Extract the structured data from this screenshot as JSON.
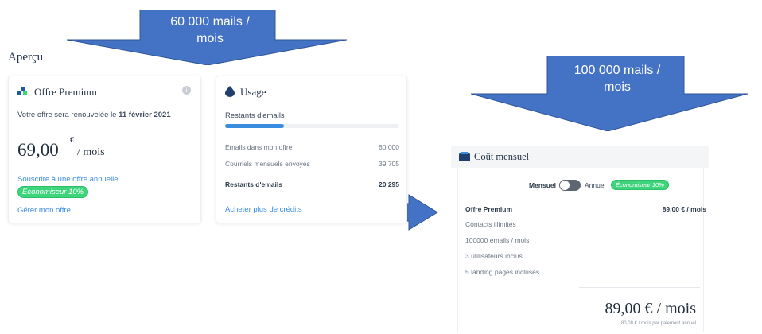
{
  "callouts": {
    "left": "60 000 mails /\nmois",
    "right": "100 000 mails /\nmois"
  },
  "section_title": "Aperçu",
  "premium": {
    "title": "Offre Premium",
    "renew_prefix": "Votre offre sera renouvelée le ",
    "renew_date": "11 février 2021",
    "price": "69,00",
    "currency": "€",
    "per": "/ mois",
    "annual_link": "Souscrire à une offre annuelle",
    "saver_badge": "Économiseur 10%",
    "manage_link": "Gérer mon offre"
  },
  "usage": {
    "title": "Usage",
    "remaining_label": "Restants d'emails",
    "progress_fraction": 0.34,
    "rows": [
      {
        "label": "Emails dans mon offre",
        "value": "60 000"
      },
      {
        "label": "Courriels mensuels envoyés",
        "value": "39 705"
      }
    ],
    "total_label": "Restants d'emails",
    "total_value": "20 295",
    "buy_link": "Acheter plus de crédits"
  },
  "monthly": {
    "title": "Coût mensuel",
    "toggle_left": "Mensuel",
    "toggle_right": "Annuel",
    "saver_badge": "Économiseur 10%",
    "plan_name": "Offre Premium",
    "plan_price": "89,00 € / mois",
    "features": [
      "Contacts illimités",
      "100000 emails / mois",
      "3 utilisateurs inclus",
      "5 landing pages incluses"
    ],
    "total": "89,00 € / mois",
    "footnote": "80,08 € / mois par paiement annuel"
  },
  "colors": {
    "arrow": "#4472c4",
    "accent": "#3b8de0",
    "badge": "#3ed47c"
  }
}
